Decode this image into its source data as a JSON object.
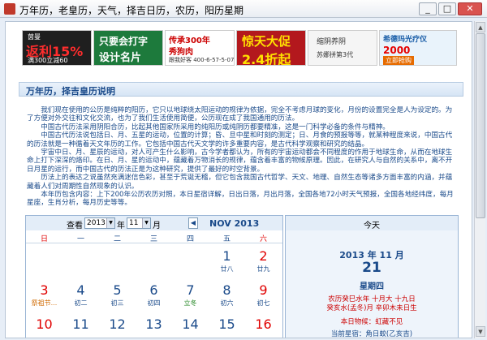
{
  "window": {
    "title": "万年历，老皇历，天气，择吉日历，农历，阳历星期",
    "min": "_",
    "max": "□",
    "close": "✕"
  },
  "ads": [
    {
      "brand": "茵曼",
      "big": "返利15%",
      "small": "满300立减60"
    },
    {
      "l1": "只要会打字",
      "l2": "设计名片"
    },
    {
      "l1": "传承300年",
      "l2": "秀狗肉",
      "l3": "跟我好客 400-6-57-5-07"
    },
    {
      "l1": "惊天大促",
      "l2": "2.4折起"
    },
    {
      "l1": "缩阴养阴",
      "l2": "苏娜拼第3代"
    },
    {
      "l1": "希德玛光疗仪",
      "l2": "2000",
      "l3": "立即抢购"
    }
  ],
  "intro": {
    "title": "万年历，择吉皇历说明",
    "paragraphs": [
      "我们现在使用的公历是纯粹的阳历，它只以地球绕太阳运动的规律为依据，完全不考虑月球的变化，月份的设置完全是人为设定的。为了方便对外交往和文化交流，也为了我们生活使用简便，公历现在成了我国通用的历法。",
      "中国古代历法采用阴阳合历，比起其他国家所采用的纯阳历或纯阴历都要精准，这是一门科学必备的条件与精神。",
      "中国古代历法说包括日、月、五星的运动，位置的计算；昏、旦中星和时刻的测定；日、月食的预报等等，就某种程度来说，中国古代的历法就是一种循着天文年历的工作。它包括中国古代天文学的许多重要内容，是古代科学观察和研究的结晶。",
      "宇宙中日、月、星辰的运动，对人可产生什么影响，古今学者都认为，所有的宇宙运动都会不同程度的作用于地球生命，从而在地球生命上打下深深的烙印。在日、月、星的运动中，蕴藏着万物消长的规律，蕴含着丰富的物候原理。因此，在研究人与自然的关系中，离不开日月星的运行，而中国古代的历法正是为这种研究，提供了最好的时空背景。",
      "历法上的表达之说虽然充满迷信色彩，甚至于荒诞无稽，但它包含我国古代哲学、天文、地理、自然生态等诸多方面丰富的内涵，并蕴藏着人们对周期性自然现象的认识。",
      "本年历包含内容：上下200年公历农历对照，本日星宿详解，日出日落，月出月落，全国各地72小时天气预报，全国各地经纬度，每月星座，生肖分析，每月历史等等。"
    ]
  },
  "calendar": {
    "view_label": "查看",
    "year": "2013",
    "year_suffix": "年",
    "month": "11",
    "month_suffix": "月",
    "title": "NOV 2013",
    "prev": "◀",
    "next": "▶",
    "weekdays": [
      "日",
      "一",
      "二",
      "三",
      "四",
      "五",
      "六"
    ],
    "days": [
      {
        "num": "1",
        "lunar": "廿八",
        "col": 5,
        "row": 0
      },
      {
        "num": "2",
        "lunar": "廿九",
        "col": 6,
        "row": 0
      },
      {
        "num": "3",
        "lunar": "祭祖节...",
        "col": 0,
        "row": 1
      },
      {
        "num": "4",
        "lunar": "初二",
        "col": 1,
        "row": 1
      },
      {
        "num": "5",
        "lunar": "初三",
        "col": 2,
        "row": 1
      },
      {
        "num": "6",
        "lunar": "初四",
        "col": 3,
        "row": 1
      },
      {
        "num": "7",
        "lunar": "立冬",
        "col": 4,
        "row": 1
      },
      {
        "num": "8",
        "lunar": "初六",
        "col": 5,
        "row": 1
      },
      {
        "num": "9",
        "lunar": "初七",
        "col": 6,
        "row": 1
      },
      {
        "num": "10",
        "lunar": "",
        "col": 0,
        "row": 2
      },
      {
        "num": "11",
        "lunar": "",
        "col": 1,
        "row": 2
      },
      {
        "num": "12",
        "lunar": "",
        "col": 2,
        "row": 2
      },
      {
        "num": "13",
        "lunar": "",
        "col": 3,
        "row": 2
      },
      {
        "num": "14",
        "lunar": "",
        "col": 4,
        "row": 2
      },
      {
        "num": "15",
        "lunar": "",
        "col": 5,
        "row": 2
      },
      {
        "num": "16",
        "lunar": "",
        "col": 6,
        "row": 2
      }
    ]
  },
  "today": {
    "header": "今天",
    "date": "2013 年 11 月",
    "day": "21",
    "weekday": "星期四",
    "lunar1": "农历癸巳水年 十月大 十九日",
    "lunar2": "癸亥水(孟冬)月 辛卯木未日生",
    "phenology": "本日物候：虹藏不见",
    "star": "当前星宿：角日蛟(乙亥吉)"
  },
  "colors": {
    "accent": "#1a4a8a",
    "weekend": "#e00000",
    "header_bg": "#e3edf8"
  }
}
